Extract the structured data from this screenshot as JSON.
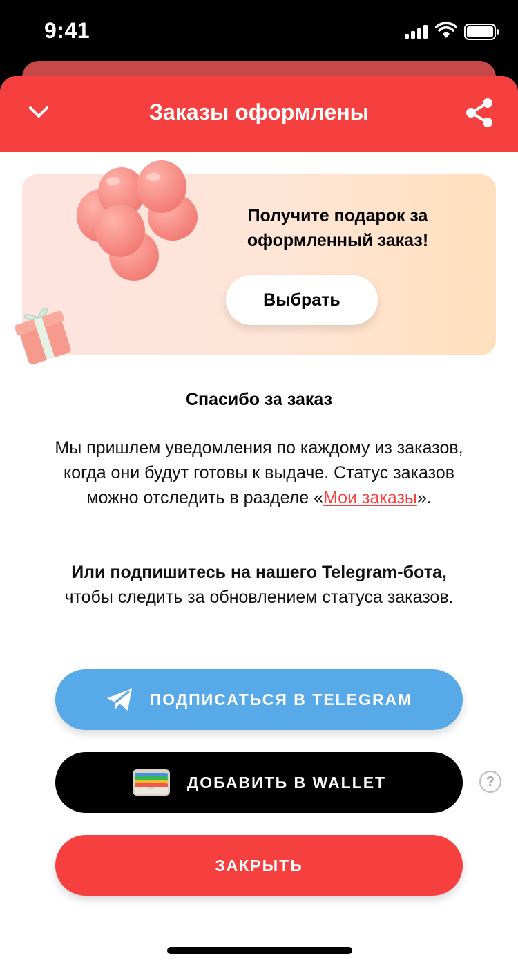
{
  "status_bar": {
    "time": "9:41"
  },
  "header": {
    "title": "Заказы оформлены"
  },
  "promo": {
    "text": "Получите подарок за оформленный заказ!",
    "button_label": "Выбрать"
  },
  "thanks_title": "Спасибо за заказ",
  "info": {
    "text_before": "Мы пришлем уведомления по каждому из заказов, когда они будут готовы к выдаче. Статус заказов можно отследить в разделе «",
    "link": "Мои заказы",
    "text_after": "»."
  },
  "subscribe": {
    "bold": "Или подпишитесь на нашего Telegram-бота,",
    "rest": " чтобы следить за обновлением статуса заказов."
  },
  "buttons": {
    "telegram": "ПОДПИСАТЬСЯ В TELEGRAM",
    "wallet": "ДОБАВИТЬ В WALLET",
    "close": "ЗАКРЫТЬ"
  },
  "help_symbol": "?",
  "colors": {
    "accent": "#f6403f",
    "telegram": "#58a9e8",
    "wallet": "#000000"
  },
  "icons": [
    "chevron-down-icon",
    "share-icon",
    "telegram-icon",
    "wallet-icon",
    "help-icon"
  ]
}
